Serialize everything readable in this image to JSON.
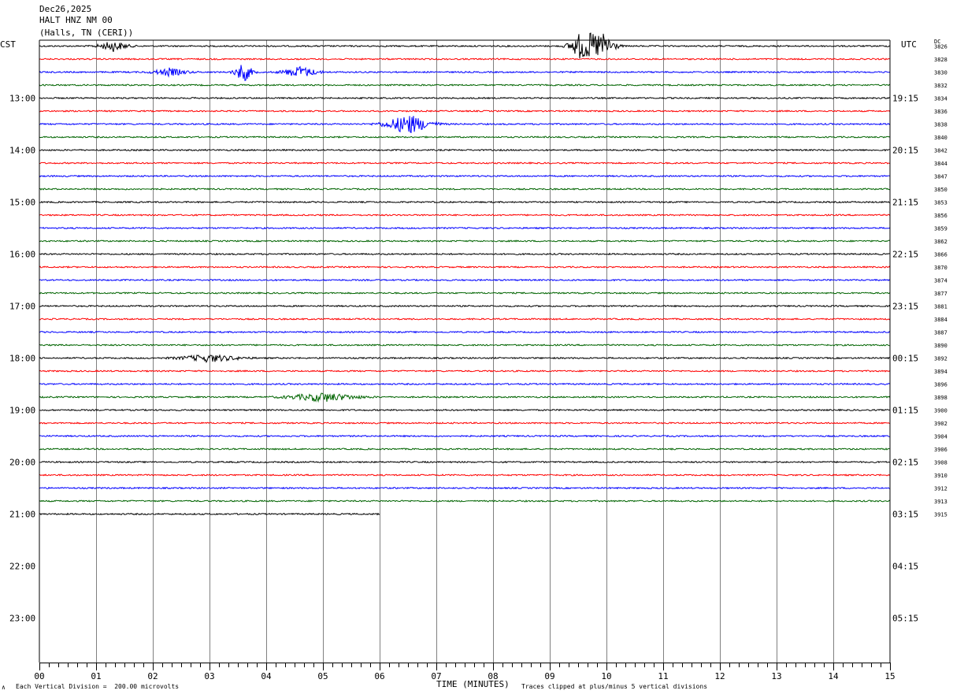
{
  "header": {
    "date": "Dec26,2025",
    "station": "HALT HNZ NM 00",
    "location": "(Halls, TN (CERI))"
  },
  "left_tz": "CST",
  "right_tz": "UTC",
  "dc_label": "DC",
  "footer": {
    "scale_note": "Each Vertical Division =  200.00 microvolts",
    "xlabel": "TIME (MINUTES)",
    "clip_note": "Traces clipped at plus/minus 5 vertical divisions",
    "corner_mark": "∧"
  },
  "colors": {
    "black": "#000000",
    "red": "#ff0000",
    "blue": "#0000ff",
    "green": "#006400",
    "grid": "#808080"
  },
  "chart_data": {
    "type": "line",
    "title": "HALT HNZ NM 00",
    "xlabel": "TIME (MINUTES)",
    "xlim": [
      0,
      15
    ],
    "x_ticks": [
      "00",
      "01",
      "02",
      "03",
      "04",
      "05",
      "06",
      "07",
      "08",
      "09",
      "10",
      "11",
      "12",
      "13",
      "14",
      "15"
    ],
    "hour_labels_left": [
      "13:00",
      "14:00",
      "15:00",
      "16:00",
      "17:00",
      "18:00",
      "19:00",
      "20:00",
      "21:00",
      "22:00",
      "23:00"
    ],
    "hour_labels_right": [
      "19:15",
      "20:15",
      "21:15",
      "22:15",
      "23:15",
      "00:15",
      "01:15",
      "02:15",
      "03:15",
      "04:15",
      "05:15"
    ],
    "trace_colors": [
      "black",
      "red",
      "blue",
      "green"
    ],
    "dc_offsets": [
      3826,
      3828,
      3830,
      3832,
      3834,
      3836,
      3838,
      3840,
      3842,
      3844,
      3847,
      3850,
      3853,
      3856,
      3859,
      3862,
      3866,
      3870,
      3874,
      3877,
      3881,
      3884,
      3887,
      3890,
      3892,
      3894,
      3896,
      3898,
      3900,
      3902,
      3904,
      3906,
      3908,
      3910,
      3912,
      3913,
      3915
    ],
    "last_trace_end_minute": 6,
    "events": [
      {
        "trace": 0,
        "minute": 9.75,
        "amplitude": 5,
        "duration": 0.6
      },
      {
        "trace": 0,
        "minute": 1.3,
        "amplitude": 0.8,
        "duration": 0.5
      },
      {
        "trace": 2,
        "minute": 3.6,
        "amplitude": 1.6,
        "duration": 0.3
      },
      {
        "trace": 2,
        "minute": 4.6,
        "amplitude": 0.9,
        "duration": 0.6
      },
      {
        "trace": 2,
        "minute": 2.3,
        "amplitude": 0.6,
        "duration": 0.6
      },
      {
        "trace": 6,
        "minute": 6.5,
        "amplitude": 1.6,
        "duration": 0.8
      },
      {
        "trace": 27,
        "minute": 5,
        "amplitude": 0.7,
        "duration": 1.2
      },
      {
        "trace": 24,
        "minute": 3,
        "amplitude": 0.6,
        "duration": 1.0
      }
    ]
  }
}
